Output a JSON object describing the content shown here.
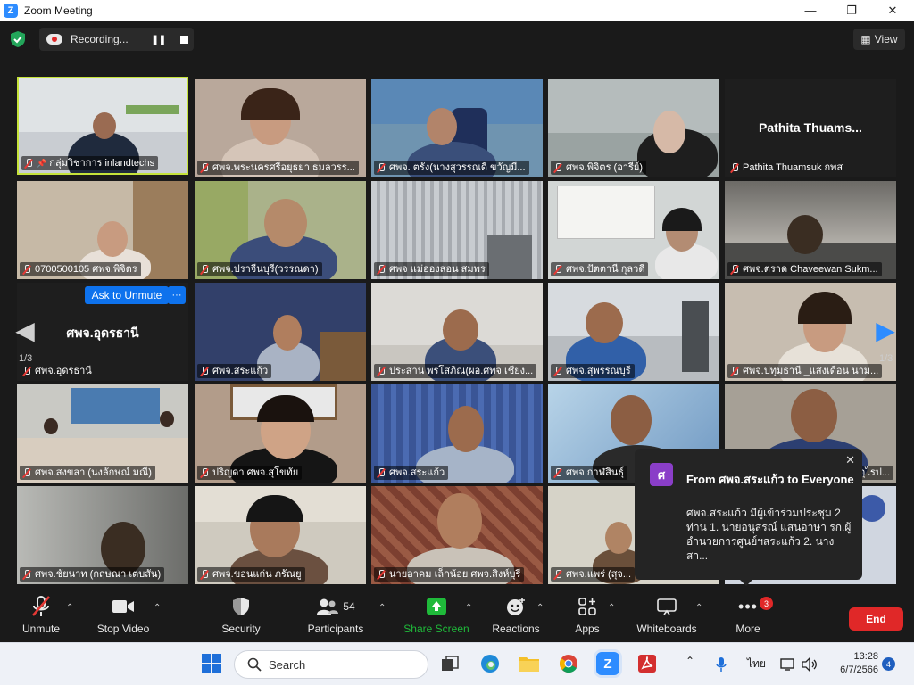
{
  "window": {
    "title": "Zoom Meeting"
  },
  "topbar": {
    "recording_label": "Recording...",
    "view_label": "View"
  },
  "gallery": {
    "page_left": "1/3",
    "page_right": "1/3",
    "ask_to_unmute_label": "Ask to Unmute",
    "more_label": "···",
    "tiles": [
      {
        "name": "กลุ่มวิชาการ inlandtechs"
      },
      {
        "name": "ศพจ.พระนครศรีอยุธยา ธมลวรร..."
      },
      {
        "name": "ศพจ. ตรัง(นางสุวรรณดี ขวัญมี..."
      },
      {
        "name": "ศพจ.พิจิตร (อารีย์)"
      },
      {
        "name": "Pathita Thuamsuk กพส",
        "display_name": "Pathita  Thuams..."
      },
      {
        "name": "0700500105 ศพจ.พิจิตร"
      },
      {
        "name": "ศพจ.ปราจีนบุรี(วรรณดา)"
      },
      {
        "name": "ศพจ แม่ฮ่องสอน สมพร"
      },
      {
        "name": "ศพจ.ปัตตานี กุลวดี"
      },
      {
        "name": "ศพจ.ตราด Chaveewan Sukm..."
      },
      {
        "name": "ศพจ.อุดรธานี",
        "display_name": "ศพจ.อุดรธานี"
      },
      {
        "name": "ศพจ.สระแก้ว"
      },
      {
        "name": "ประสาน พรโสภิณ(ผอ.ศพจ.เชียง..."
      },
      {
        "name": "ศพจ.สุพรรณบุรี"
      },
      {
        "name": "ศพจ.ปทุมธานี _แสงเดือน นาม..."
      },
      {
        "name": "ศพจ.สงขลา (นงลักษณ์ มณี)"
      },
      {
        "name": "ปริญดา ศพจ.สุโขทัย"
      },
      {
        "name": "ศพจ.สระแก้ว"
      },
      {
        "name": "ศพจ กาฬสินธุ์"
      },
      {
        "name": "อุไรป..."
      },
      {
        "name": "ศพจ.ชัยนาท (กฤษณา เตบสัน)"
      },
      {
        "name": "ศพจ.ขอนแก่น ภรัณยู"
      },
      {
        "name": "นายอาคม เล็กน้อย ศพจ.สิงห์บุรี"
      },
      {
        "name": "ศพจ.แพร่ (สุจ..."
      }
    ]
  },
  "chat_popup": {
    "avatar_letter": "ศ",
    "header": "From ศพจ.สระแก้ว to Everyone",
    "message": "ศพจ.สระแก้ว มีผู้เข้าร่วมประชุม 2 ท่าน 1. นายอนุสรณ์ แสนอาษา รก.ผู้อำนวยการศูนย์ฯสระแก้ว 2. นางสา..."
  },
  "toolbar": {
    "unmute": "Unmute",
    "stop_video": "Stop Video",
    "security": "Security",
    "participants": "Participants",
    "participants_count": "54",
    "share_screen": "Share Screen",
    "reactions": "Reactions",
    "apps": "Apps",
    "whiteboards": "Whiteboards",
    "more": "More",
    "more_badge": "3",
    "end": "End",
    "accent_green": "#1fba3a",
    "end_red": "#e02828"
  },
  "taskbar": {
    "search_label": "Search",
    "lang": "ไทย",
    "time": "13:28",
    "date": "6/7/2566",
    "notifications": "4"
  }
}
